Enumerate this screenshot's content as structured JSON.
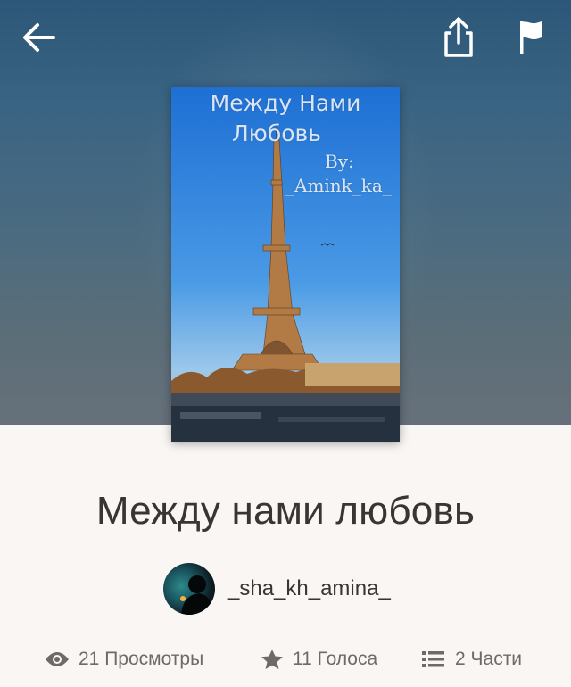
{
  "header": {
    "back_icon": "arrow-left-icon",
    "share_icon": "share-icon",
    "report_icon": "flag-icon"
  },
  "cover": {
    "line1": "Между Нами",
    "line2": "Любовь",
    "by_label": "By:",
    "byline": "_Amink_ka_"
  },
  "story": {
    "title": "Между нами любовь",
    "author": "_sha_kh_amina_"
  },
  "stats": {
    "views": "21 Просмотры",
    "votes": "11 Голоса",
    "parts": "2 Части"
  },
  "colors": {
    "background": "#f9f6f3",
    "text": "#3a3532",
    "muted": "#6f6a66"
  }
}
